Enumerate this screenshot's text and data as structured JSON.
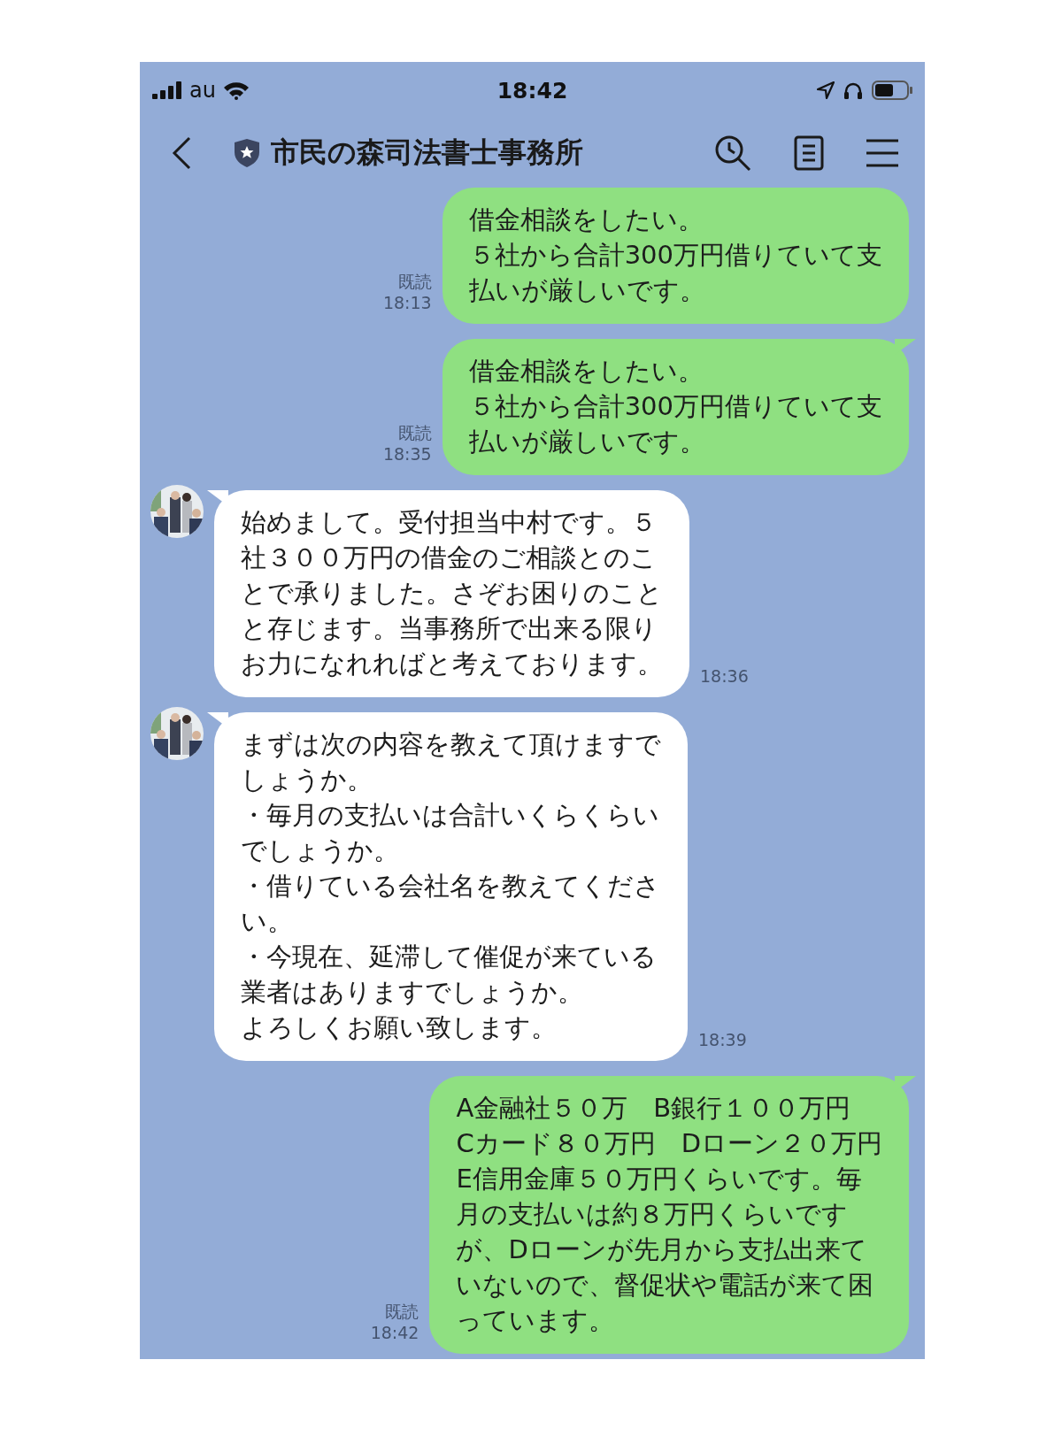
{
  "status_bar": {
    "carrier": "au",
    "time": "18:42"
  },
  "header": {
    "title": "市民の森司法書士事務所"
  },
  "messages": [
    {
      "kind": "sent",
      "tail": false,
      "read": "既読",
      "time": "18:13",
      "lines": [
        "借金相談をしたい。",
        "５社から合計300万円借りていて支",
        "払いが厳しいです。"
      ]
    },
    {
      "kind": "sent",
      "tail": true,
      "read": "既読",
      "time": "18:35",
      "lines": [
        "借金相談をしたい。",
        "５社から合計300万円借りていて支",
        "払いが厳しいです。"
      ]
    },
    {
      "kind": "received",
      "tail": true,
      "time": "18:36",
      "lines": [
        "始めまして。受付担当中村です。５",
        "社３００万円の借金のご相談とのこ",
        "とで承りました。さぞお困りのこと",
        "と存じます。当事務所で出来る限り",
        "お力になれればと考えております。"
      ]
    },
    {
      "kind": "received",
      "tail": true,
      "time": "18:39",
      "lines": [
        "まずは次の内容を教えて頂けますで",
        "しょうか。",
        "・毎月の支払いは合計いくらくらい",
        "でしょうか。",
        "・借りている会社名を教えてくださ",
        "い。",
        "・今現在、延滞して催促が来ている",
        "業者はありますでしょうか。",
        "よろしくお願い致します。"
      ]
    },
    {
      "kind": "sent",
      "tail": true,
      "read": "既読",
      "time": "18:42",
      "lines": [
        "A金融社５０万　B銀行１００万円",
        "Cカード８０万円　Dローン２０万円",
        "E信用金庫５０万円くらいです。毎",
        "月の支払いは約８万円くらいです",
        "が、Dローンが先月から支払出来て",
        "いないので、督促状や電話が来て困",
        "っています。"
      ]
    }
  ]
}
